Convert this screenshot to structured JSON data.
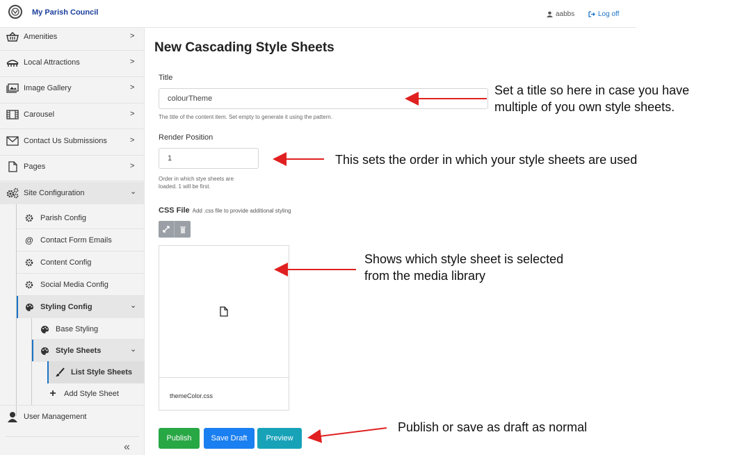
{
  "header": {
    "brand": "My Parish Council",
    "username": "aabbs",
    "logoff": "Log off"
  },
  "sidebar": {
    "items": [
      {
        "label": "Amenities",
        "icon": "basket-icon"
      },
      {
        "label": "Local Attractions",
        "icon": "landmark-icon"
      },
      {
        "label": "Image Gallery",
        "icon": "image-gallery-icon"
      },
      {
        "label": "Carousel",
        "icon": "film-icon"
      },
      {
        "label": "Contact Us Submissions",
        "icon": "envelope-icon"
      },
      {
        "label": "Pages",
        "icon": "file-icon"
      },
      {
        "label": "Site Configuration",
        "icon": "cogs-icon"
      },
      {
        "label": "Parish Config",
        "icon": "cog-icon"
      },
      {
        "label": "Contact Form Emails",
        "icon": "at-icon"
      },
      {
        "label": "Content Config",
        "icon": "cog-icon"
      },
      {
        "label": "Social Media Config",
        "icon": "cog-icon"
      },
      {
        "label": "Styling Config",
        "icon": "palette-icon"
      },
      {
        "label": "Base Styling",
        "icon": "palette-icon"
      },
      {
        "label": "Style Sheets",
        "icon": "palette-icon"
      },
      {
        "label": "List Style Sheets",
        "icon": "brush-icon"
      },
      {
        "label": "Add Style Sheet",
        "icon": "plus-icon"
      },
      {
        "label": "User Management",
        "icon": "user-icon"
      }
    ]
  },
  "main": {
    "title": "New Cascading Style Sheets",
    "title_field": {
      "label": "Title",
      "value": "colourTheme",
      "help": "The title of the content item. Set empty to generate it using the pattern."
    },
    "render_position": {
      "label": "Render Position",
      "value": "1",
      "help_line1": "Order in which stye sheets are",
      "help_line2": "loaded. 1 will be first."
    },
    "css_file": {
      "label": "CSS File",
      "help": "Add .css file to provide additional styling",
      "filename": "themeColor.css"
    },
    "buttons": {
      "publish": "Publish",
      "save_draft": "Save Draft",
      "preview": "Preview"
    }
  },
  "annotations": {
    "title_note_1": "Set a title so here in case you have",
    "title_note_2": "multiple of you own style sheets.",
    "render_note": "This sets the order in which your style sheets are used",
    "media_note_1": "Shows which style sheet is selected",
    "media_note_2": "from the media library",
    "buttons_note": "Publish or save as draft as normal"
  },
  "colors": {
    "brand": "#1b3f9c",
    "link": "#1a73c6",
    "publish": "#28a745",
    "save_draft": "#1a7ff0",
    "preview": "#17a2b8",
    "annotation_arrow": "#e02020"
  }
}
